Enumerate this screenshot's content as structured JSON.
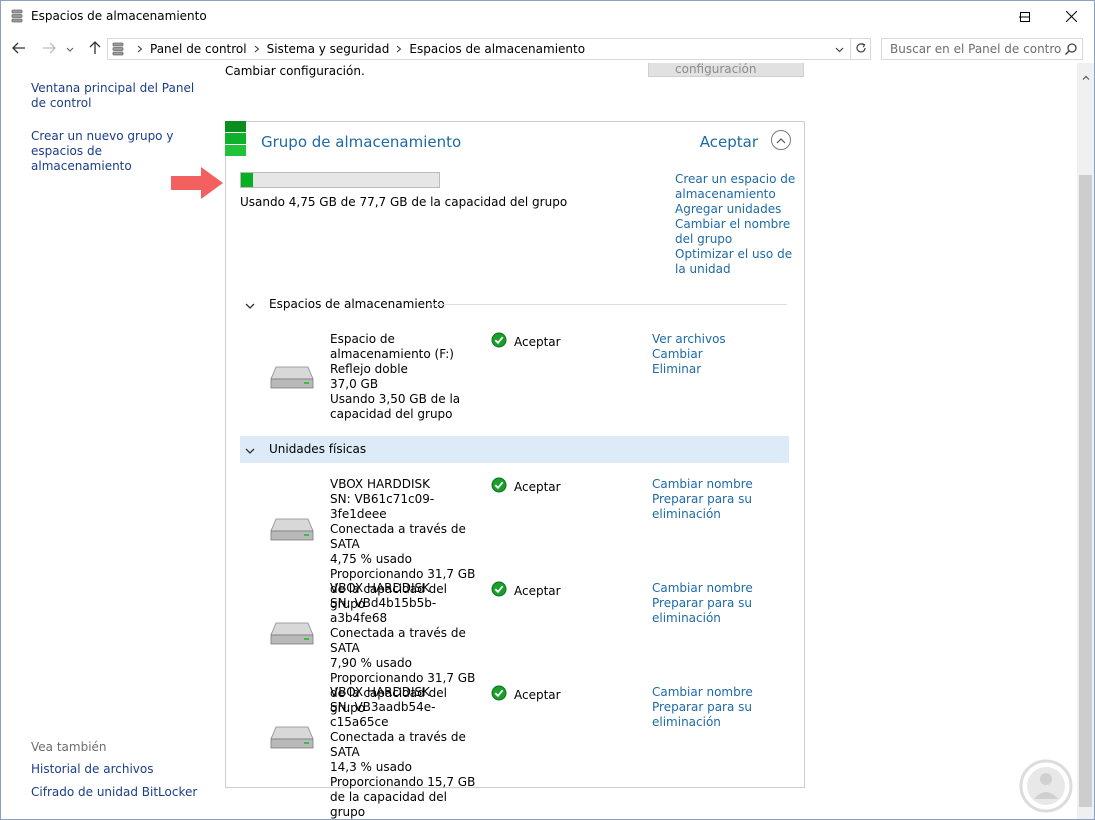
{
  "window": {
    "title": "Espacios de almacenamiento"
  },
  "nav": {
    "breadcrumbs": [
      "Panel de control",
      "Sistema y seguridad",
      "Espacios de almacenamiento"
    ],
    "search_placeholder": "Buscar en el Panel de control"
  },
  "left_pane": {
    "links": [
      "Ventana principal del Panel de control",
      "Crear un nuevo grupo y espacios de almacenamiento"
    ],
    "see_also_label": "Vea también",
    "see_also_links": [
      "Historial de archivos",
      "Cifrado de unidad BitLocker"
    ]
  },
  "top_cut": {
    "text": "Cambiar configuración.",
    "button": "Cambiar configuración"
  },
  "pool": {
    "title": "Grupo de almacenamiento",
    "status": "Aceptar",
    "usage_text": "Usando 4,75 GB de 77,7 GB de la capacidad del grupo",
    "usage_fraction": 0.061,
    "actions": [
      "Crear un espacio de almacenamiento",
      "Agregar unidades",
      "Cambiar el nombre del grupo",
      "Optimizar el uso de la unidad"
    ]
  },
  "spaces_section": {
    "title": "Espacios de almacenamiento",
    "items": [
      {
        "lines": [
          "Espacio de almacenamiento (F:)",
          "Reflejo doble",
          "37,0 GB",
          "Usando 3,50 GB de la capacidad del grupo"
        ],
        "status": "Aceptar",
        "links": [
          "Ver archivos",
          "Cambiar",
          "Eliminar"
        ]
      }
    ]
  },
  "physical_section": {
    "title": "Unidades físicas",
    "items": [
      {
        "lines": [
          "VBOX HARDDISK",
          "SN: VB61c71c09-3fe1deee",
          "Conectada a través de SATA",
          "4,75 % usado",
          "Proporcionando 31,7 GB de la capacidad del grupo"
        ],
        "status": "Aceptar",
        "links": [
          "Cambiar nombre",
          "Preparar para su eliminación"
        ]
      },
      {
        "lines": [
          "VBOX HARDDISK",
          "SN: VBd4b15b5b-a3b4fe68",
          "Conectada a través de SATA",
          "7,90 % usado",
          "Proporcionando 31,7 GB de la capacidad del grupo"
        ],
        "status": "Aceptar",
        "links": [
          "Cambiar nombre",
          "Preparar para su eliminación"
        ]
      },
      {
        "lines": [
          "VBOX HARDDISK",
          "SN: VB3aadb54e-c15a65ce",
          "Conectada a través de SATA",
          "14,3 % usado",
          "Proporcionando 15,7 GB de la capacidad del grupo"
        ],
        "status": "Aceptar",
        "links": [
          "Cambiar nombre",
          "Preparar para su eliminación"
        ]
      }
    ]
  },
  "colors": {
    "link": "#1e6aa5",
    "accent_green": "#06b025",
    "annotation_arrow": "#f26060",
    "section_highlight": "#dcebf7"
  },
  "icons": [
    "storage-spaces-icon",
    "back-arrow-icon",
    "forward-arrow-icon",
    "recent-dropdown-icon",
    "up-arrow-icon",
    "search-icon",
    "refresh-icon",
    "drive-icon",
    "check-ok-icon",
    "chevron-up-icon",
    "chevron-down-icon"
  ]
}
